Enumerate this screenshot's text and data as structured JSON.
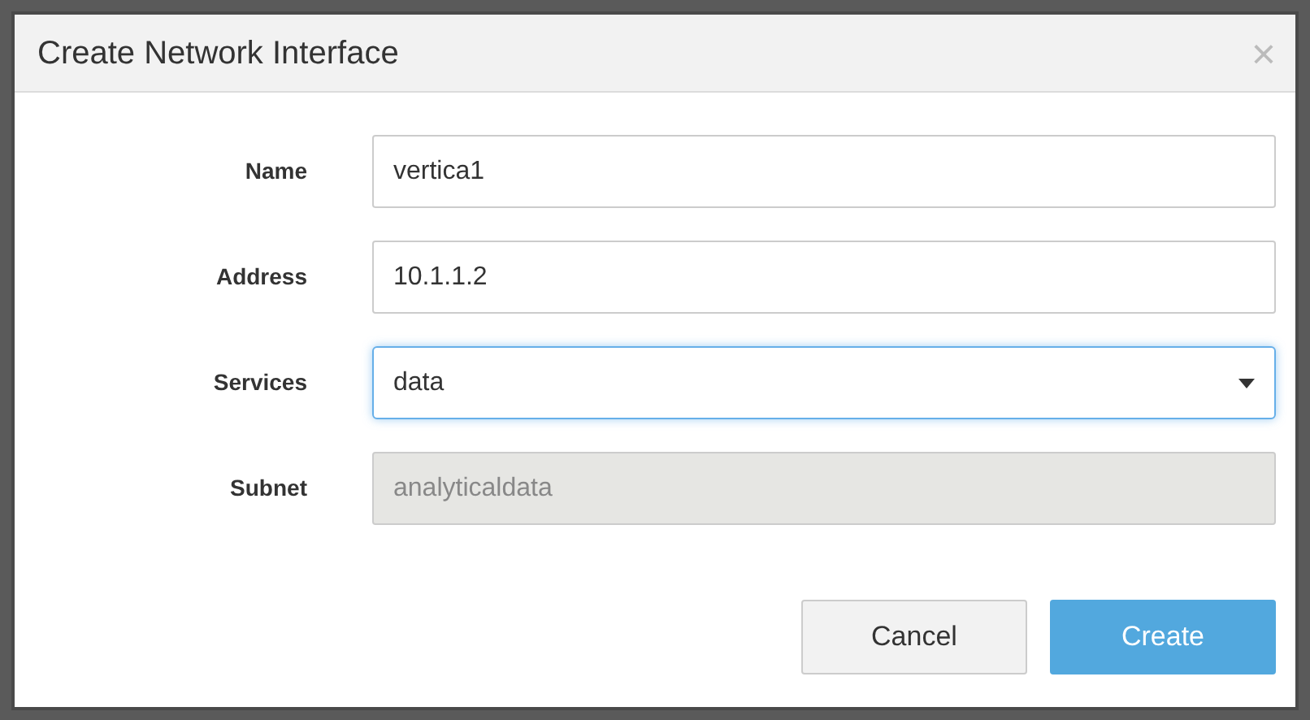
{
  "dialog": {
    "title": "Create Network Interface",
    "close": "×"
  },
  "fields": [
    {
      "label": "Name",
      "value": "vertica1",
      "kind": "text",
      "focused": false,
      "disabled": false
    },
    {
      "label": "Address",
      "value": "10.1.1.2",
      "kind": "text",
      "focused": false,
      "disabled": false
    },
    {
      "label": "Services",
      "value": "data",
      "kind": "select",
      "focused": true,
      "disabled": false
    },
    {
      "label": "Subnet",
      "value": "analyticaldata",
      "kind": "text",
      "focused": false,
      "disabled": true
    }
  ],
  "buttons": [
    {
      "label": "Cancel",
      "kind": "secondary"
    },
    {
      "label": "Create",
      "kind": "primary"
    }
  ]
}
